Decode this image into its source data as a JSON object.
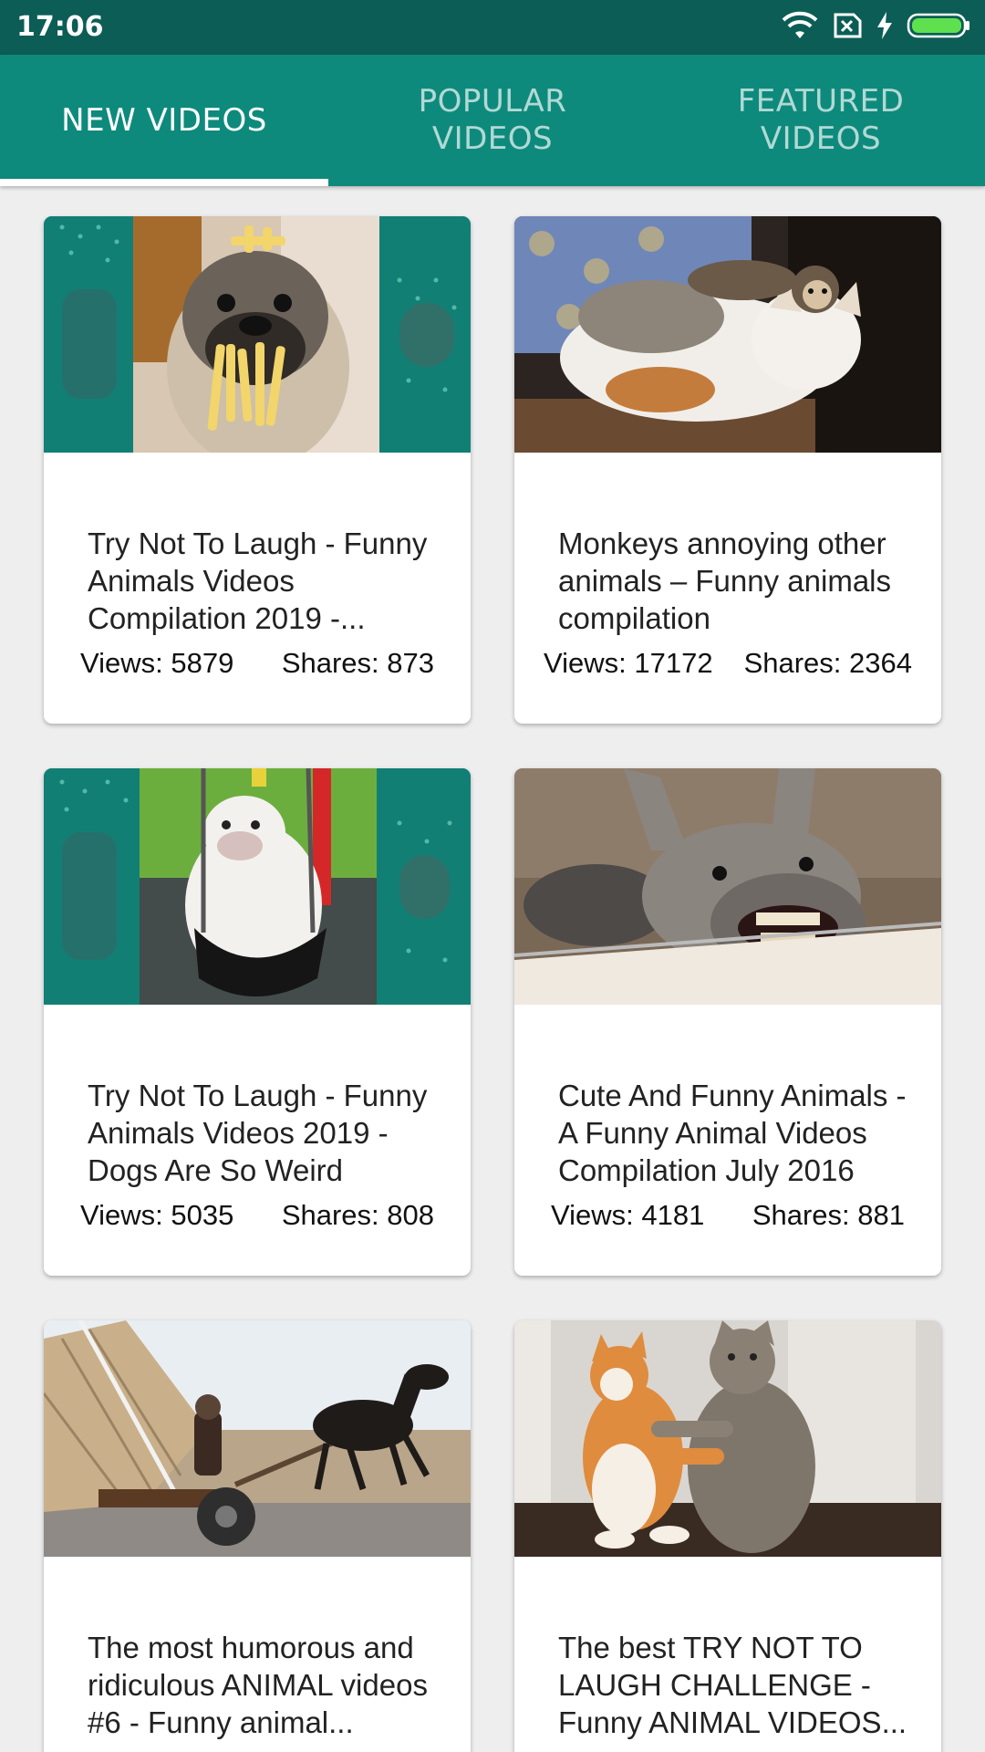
{
  "status_bar": {
    "time": "17:06",
    "icons": [
      "wifi-icon",
      "no-sim-icon",
      "charging-icon",
      "battery-icon"
    ]
  },
  "tabs": [
    {
      "label": "NEW VIDEOS",
      "active": true
    },
    {
      "label": "POPULAR VIDEOS",
      "active": false
    },
    {
      "label": "FEATURED VIDEOS",
      "active": false
    }
  ],
  "colors": {
    "status_bar": "#0c5d55",
    "tab_bar": "#0e8a7c",
    "background": "#eeeeee"
  },
  "videos": [
    {
      "title": "Try Not To Laugh - Funny Animals Videos Compilation 2019 -...",
      "views": "Views: 5879",
      "shares": "Shares: 873",
      "thumbnail": "pug-with-fries-thumbnail"
    },
    {
      "title": "Monkeys annoying other animals – Funny animals compilation",
      "views": "Views: 17172",
      "shares": "Shares: 2364",
      "thumbnail": "monkey-on-cat-thumbnail"
    },
    {
      "title": "Try Not To Laugh - Funny Animals Videos 2019 - Dogs Are So Weird",
      "views": "Views: 5035",
      "shares": "Shares: 808",
      "thumbnail": "bulldog-in-swing-thumbnail"
    },
    {
      "title": "Cute And Funny Animals - A Funny Animal Videos Compilation July 2016",
      "views": "Views: 4181",
      "shares": "Shares: 881",
      "thumbnail": "laughing-donkey-thumbnail"
    },
    {
      "title": "The most humorous and ridiculous ANIMAL videos #6 - Funny animal...",
      "views": "",
      "shares": "",
      "thumbnail": "horse-cart-thumbnail"
    },
    {
      "title": "The best TRY NOT TO LAUGH CHALLENGE - Funny ANIMAL VIDEOS...",
      "views": "",
      "shares": "",
      "thumbnail": "cats-dancing-thumbnail"
    }
  ]
}
